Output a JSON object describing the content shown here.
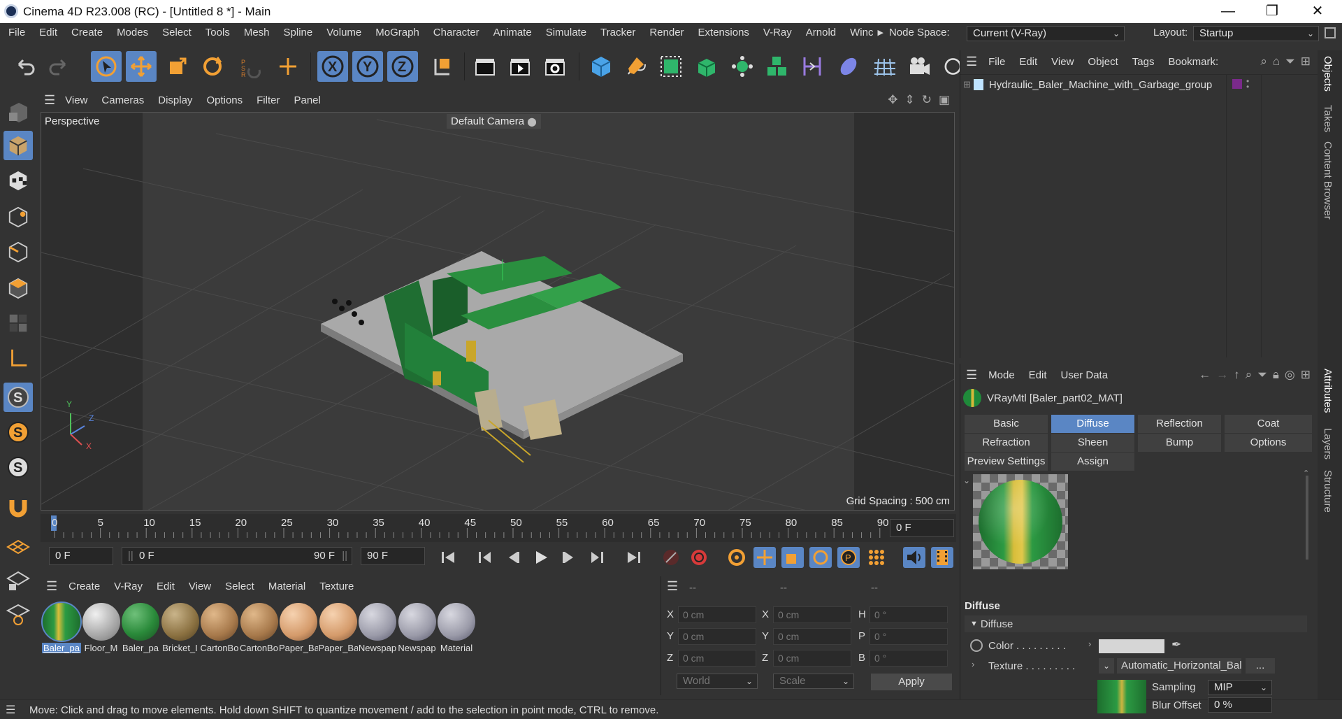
{
  "window": {
    "title": "Cinema 4D R23.008 (RC) - [Untitled 8 *] - Main",
    "controls": [
      "—",
      "❐",
      "✕"
    ]
  },
  "menubar": {
    "items": [
      "File",
      "Edit",
      "Create",
      "Modes",
      "Select",
      "Tools",
      "Mesh",
      "Spline",
      "Volume",
      "MoGraph",
      "Character",
      "Animate",
      "Simulate",
      "Tracker",
      "Render",
      "Extensions",
      "V-Ray",
      "Arnold",
      "Winc"
    ],
    "node_space_label": "Node Space:",
    "node_space_value": "Current (V-Ray)",
    "layout_label": "Layout:",
    "layout_value": "Startup"
  },
  "toolbar": {
    "axis_labels": [
      "X",
      "Y",
      "Z"
    ]
  },
  "viewport": {
    "menu": [
      "View",
      "Cameras",
      "Display",
      "Options",
      "Filter",
      "Panel"
    ],
    "view_name": "Perspective",
    "camera": "Default Camera",
    "grid_spacing": "Grid Spacing : 500 cm",
    "axis_labels": [
      "Y",
      "Z",
      "X"
    ]
  },
  "timeline": {
    "ticks": [
      "0",
      "5",
      "10",
      "15",
      "20",
      "25",
      "30",
      "35",
      "40",
      "45",
      "50",
      "55",
      "60",
      "65",
      "70",
      "75",
      "80",
      "85",
      "90"
    ],
    "current_frame": "0 F",
    "start_field": "0 F",
    "range_start": "0 F",
    "range_end": "90 F",
    "end_field": "90 F"
  },
  "material_manager": {
    "menu": [
      "Create",
      "V-Ray",
      "Edit",
      "View",
      "Select",
      "Material",
      "Texture"
    ],
    "materials": [
      {
        "name": "Baler_pa",
        "selected": true,
        "color": "green-yellow"
      },
      {
        "name": "Floor_M",
        "selected": false,
        "color": "grey"
      },
      {
        "name": "Baler_pa",
        "selected": false,
        "color": "green"
      },
      {
        "name": "Bricket_I",
        "selected": false,
        "color": "brown"
      },
      {
        "name": "CartonBo",
        "selected": false,
        "color": "tan"
      },
      {
        "name": "CartonBo",
        "selected": false,
        "color": "tan"
      },
      {
        "name": "Paper_Ba",
        "selected": false,
        "color": "peach"
      },
      {
        "name": "Paper_Ba",
        "selected": false,
        "color": "peach"
      },
      {
        "name": "Newspap",
        "selected": false,
        "color": "paper"
      },
      {
        "name": "Newspap",
        "selected": false,
        "color": "paper"
      },
      {
        "name": "Material",
        "selected": false,
        "color": "paper"
      }
    ]
  },
  "coordinates": {
    "headers": [
      "--",
      "--",
      "--"
    ],
    "rows": [
      {
        "l1": "X",
        "v1": "0 cm",
        "l2": "X",
        "v2": "0 cm",
        "l3": "H",
        "v3": "0 °"
      },
      {
        "l1": "Y",
        "v1": "0 cm",
        "l2": "Y",
        "v2": "0 cm",
        "l3": "P",
        "v3": "0 °"
      },
      {
        "l1": "Z",
        "v1": "0 cm",
        "l2": "Z",
        "v2": "0 cm",
        "l3": "B",
        "v3": "0 °"
      }
    ],
    "world": "World",
    "scale": "Scale",
    "apply": "Apply"
  },
  "status": {
    "text": "Move: Click and drag to move elements. Hold down SHIFT to quantize movement / add to the selection in point mode, CTRL to remove."
  },
  "object_manager": {
    "menu": [
      "File",
      "Edit",
      "View",
      "Object",
      "Tags",
      "Bookmark:"
    ],
    "object_name": "Hydraulic_Baler_Machine_with_Garbage_group"
  },
  "attributes": {
    "menu": [
      "Mode",
      "Edit",
      "User Data"
    ],
    "material_title": "VRayMtl [Baler_part02_MAT]",
    "tabs_row1": [
      "Basic",
      "Diffuse",
      "Reflection",
      "Coat"
    ],
    "tabs_row2": [
      "Refraction",
      "Sheen",
      "Bump",
      "Options"
    ],
    "tabs_row3": [
      "Preview Settings",
      "Assign"
    ],
    "active_tab": "Diffuse",
    "section_title": "Diffuse",
    "group_title": "Diffuse",
    "color_label": "Color . . . . . . . . .",
    "texture_label": "Texture . . . . . . . . .",
    "texture_value": "Automatic_Horizontal_Baler",
    "texture_more": "...",
    "sampling_label": "Sampling",
    "sampling_value": "MIP",
    "blur_label": "Blur Offset",
    "blur_value": "0 %"
  },
  "side_tabs": [
    "Objects",
    "Takes",
    "Content Browser",
    "Attributes",
    "Layers",
    "Structure"
  ]
}
